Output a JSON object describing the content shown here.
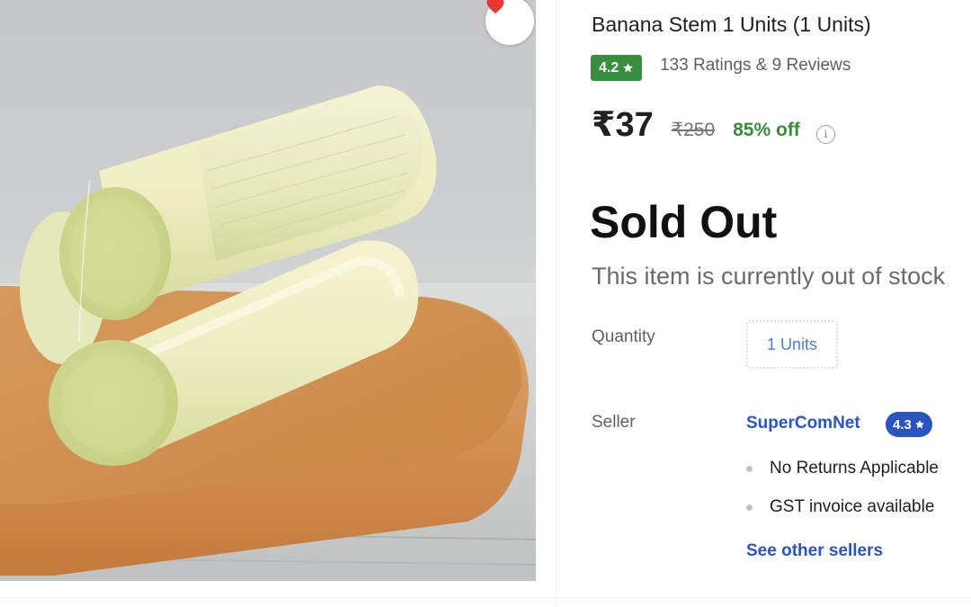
{
  "product": {
    "title": "Banana Stem 1 Units  (1 Units)",
    "rating": "4.2",
    "ratings_summary": "133 Ratings & 9 Reviews",
    "price": "₹37",
    "mrp": "₹250",
    "discount": "85% off",
    "info_glyph": "i",
    "status": "Sold Out",
    "status_message": "This item is currently out of stock"
  },
  "quantity": {
    "label": "Quantity",
    "value": "1 Units"
  },
  "seller": {
    "label": "Seller",
    "name": "SuperComNet",
    "rating": "4.3",
    "features": [
      "No Returns Applicable",
      "GST invoice available"
    ],
    "see_other_label": "See other sellers"
  },
  "icons": {
    "wishlist": "heart-icon",
    "rating_star": "star-icon",
    "info": "info-icon",
    "seller_star": "star-icon"
  },
  "colors": {
    "rating_green": "#388e3c",
    "discount_green": "#388e3c",
    "seller_blue": "#2a55c0",
    "wishlist_red": "#e53935"
  }
}
